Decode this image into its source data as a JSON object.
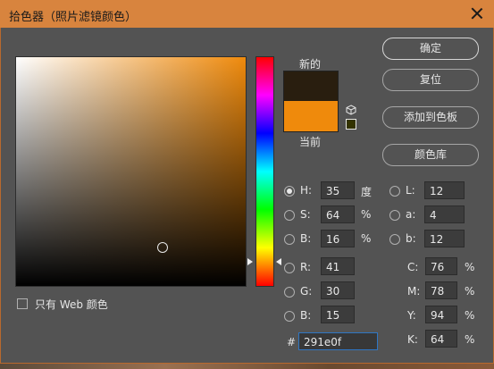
{
  "dialog": {
    "title": "拾色器（照片滤镜颜色）"
  },
  "swatches": {
    "new_label": "新的",
    "current_label": "当前",
    "new_color": "#291e0f",
    "current_color": "#ef8a0c"
  },
  "buttons": {
    "ok": "确定",
    "reset": "复位",
    "add_to_swatches": "添加到色板",
    "color_libraries": "颜色库"
  },
  "web_only": {
    "label": "只有 Web 颜色",
    "checked": false
  },
  "hsb": {
    "h": {
      "label": "H:",
      "value": "35",
      "unit": "度",
      "selected": true
    },
    "s": {
      "label": "S:",
      "value": "64",
      "unit": "%"
    },
    "b": {
      "label": "B:",
      "value": "16",
      "unit": "%"
    }
  },
  "rgb": {
    "r": {
      "label": "R:",
      "value": "41"
    },
    "g": {
      "label": "G:",
      "value": "30"
    },
    "b": {
      "label": "B:",
      "value": "15"
    }
  },
  "lab": {
    "l": {
      "label": "L:",
      "value": "12"
    },
    "a": {
      "label": "a:",
      "value": "4"
    },
    "b": {
      "label": "b:",
      "value": "12"
    }
  },
  "cmyk": {
    "c": {
      "label": "C:",
      "value": "76",
      "unit": "%"
    },
    "m": {
      "label": "M:",
      "value": "78",
      "unit": "%"
    },
    "y": {
      "label": "Y:",
      "value": "94",
      "unit": "%"
    },
    "k": {
      "label": "K:",
      "value": "64",
      "unit": "%"
    }
  },
  "hex": {
    "label": "#",
    "value": "291e0f"
  },
  "icons": {
    "close": "close-icon",
    "cube": "cube-icon",
    "warning_swatch": "web-safe-swatch"
  }
}
